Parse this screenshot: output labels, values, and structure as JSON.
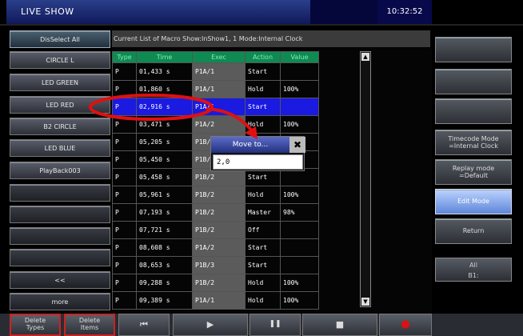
{
  "title": "LIVE SHOW",
  "clock": "10:32:52",
  "header_text": "Current List of Macro Show:InShow1, 1  Mode:Internal Clock",
  "left_buttons": [
    "DisSelect All",
    "CIRCLE L",
    "LED GREEN",
    "LED RED",
    "B2 CIRCLE",
    "LED BLUE",
    "PlayBack003",
    "",
    "",
    "",
    "",
    "<<",
    "more"
  ],
  "table": {
    "columns": [
      "Type",
      "Time",
      "Exec",
      "Action",
      "Value"
    ],
    "rows": [
      {
        "type": "P",
        "time": "01,433 s",
        "exec": "P1A/1",
        "action": "Start",
        "value": ""
      },
      {
        "type": "P",
        "time": "01,860 s",
        "exec": "P1A/1",
        "action": "Hold",
        "value": "100%"
      },
      {
        "type": "P",
        "time": "02,916 s",
        "exec": "P1A/1",
        "action": "Start",
        "value": ""
      },
      {
        "type": "P",
        "time": "03,471 s",
        "exec": "P1A/2",
        "action": "Hold",
        "value": "100%"
      },
      {
        "type": "P",
        "time": "05,205 s",
        "exec": "P1B/1",
        "action": "",
        "value": ""
      },
      {
        "type": "P",
        "time": "05,450 s",
        "exec": "P1B/1",
        "action": "",
        "value": ""
      },
      {
        "type": "P",
        "time": "05,458 s",
        "exec": "P1B/2",
        "action": "Start",
        "value": ""
      },
      {
        "type": "P",
        "time": "05,961 s",
        "exec": "P1B/2",
        "action": "Hold",
        "value": "100%"
      },
      {
        "type": "P",
        "time": "07,193 s",
        "exec": "P1B/2",
        "action": "Master",
        "value": "98%"
      },
      {
        "type": "P",
        "time": "07,721 s",
        "exec": "P1B/2",
        "action": "Off",
        "value": ""
      },
      {
        "type": "P",
        "time": "08,608 s",
        "exec": "P1A/2",
        "action": "Start",
        "value": ""
      },
      {
        "type": "P",
        "time": "08,653 s",
        "exec": "P1B/3",
        "action": "Start",
        "value": ""
      },
      {
        "type": "P",
        "time": "09,288 s",
        "exec": "P1B/2",
        "action": "Hold",
        "value": "100%"
      },
      {
        "type": "P",
        "time": "09,389 s",
        "exec": "P1A/1",
        "action": "Hold",
        "value": "100%"
      }
    ],
    "selected_index": 2
  },
  "right_buttons": [
    "",
    "",
    "",
    "Timecode Mode\n=Internal Clock",
    "Replay mode\n=Default",
    "Edit Mode",
    "Return"
  ],
  "right_panel": {
    "line1": "All",
    "line2": "B1:"
  },
  "bottom": {
    "delete_types": "Delete\nTypes",
    "delete_items": "Delete\nItems",
    "rewind": "⏮",
    "play": "▶",
    "pause": "❚❚",
    "stop": "■",
    "record": "●"
  },
  "dialog": {
    "title": "Move to...",
    "close": "✖",
    "value": "2,0"
  },
  "colors": {
    "accent": "#1a1ae0",
    "header_green": "#0f8a52",
    "annotation_red": "#e01010"
  }
}
